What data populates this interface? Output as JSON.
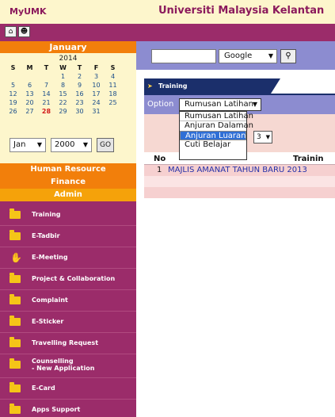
{
  "header": {
    "brand": "MyUMK",
    "university": "Universiti Malaysia Kelantan"
  },
  "calendar": {
    "month": "January",
    "year": "2014",
    "weekdays": [
      "S",
      "M",
      "T",
      "W",
      "T",
      "F",
      "S"
    ],
    "weeks": [
      [
        "",
        "",
        "",
        "1",
        "2",
        "3",
        "4"
      ],
      [
        "5",
        "6",
        "7",
        "8",
        "9",
        "10",
        "11"
      ],
      [
        "12",
        "13",
        "14",
        "15",
        "16",
        "17",
        "18"
      ],
      [
        "19",
        "20",
        "21",
        "22",
        "23",
        "24",
        "25"
      ],
      [
        "26",
        "27",
        "28",
        "29",
        "30",
        "31",
        ""
      ]
    ],
    "highlighted_day": "28",
    "month_select": "Jan",
    "year_select": "2000",
    "go_label": "GO"
  },
  "menu_sections": {
    "human_resource": "Human Resource",
    "finance": "Finance",
    "admin": "Admin"
  },
  "sidebar_items": [
    {
      "label": "Training",
      "icon": "folder-icon"
    },
    {
      "label": "E-Tadbir",
      "icon": "folder-icon"
    },
    {
      "label": "E-Meeting",
      "icon": "hand-icon"
    },
    {
      "label": "Project & Collaboration",
      "icon": "folder-icon"
    },
    {
      "label": "Complaint",
      "icon": "folder-icon"
    },
    {
      "label": "E-Sticker",
      "icon": "folder-icon"
    },
    {
      "label": "Travelling Request",
      "icon": "folder-icon"
    },
    {
      "label": "Counselling\n- New Application",
      "icon": "folder-icon"
    },
    {
      "label": "E-Card",
      "icon": "folder-icon"
    },
    {
      "label": "Apps Support",
      "icon": "folder-icon"
    }
  ],
  "search": {
    "engine": "Google",
    "query": ""
  },
  "main": {
    "tab_label": "Training",
    "option_label": "Option",
    "option_selected": "Rumusan Latihan",
    "dropdown_options": [
      "Rumusan Latihan",
      "Anjuran Dalaman",
      "Anjuran Luaran",
      "Cuti Belajar"
    ],
    "dropdown_highlighted": "Anjuran Luaran",
    "mini_select": "3",
    "table": {
      "columns": [
        "No",
        "Trainin"
      ],
      "rows": [
        {
          "no": "1",
          "training": "MAJLIS AMANAT TAHUN BARU 2013"
        }
      ]
    }
  },
  "colors": {
    "header_bg": "#fdf6cc",
    "brand": "#8b1a5c",
    "sidebar_bg": "#9b2c6a",
    "accent_orange": "#f27f0b",
    "tab_navy": "#1b2f6b",
    "search_bar": "#8c8cd0",
    "row_pink": "#f6d0d0",
    "link_blue": "#2530a8"
  }
}
